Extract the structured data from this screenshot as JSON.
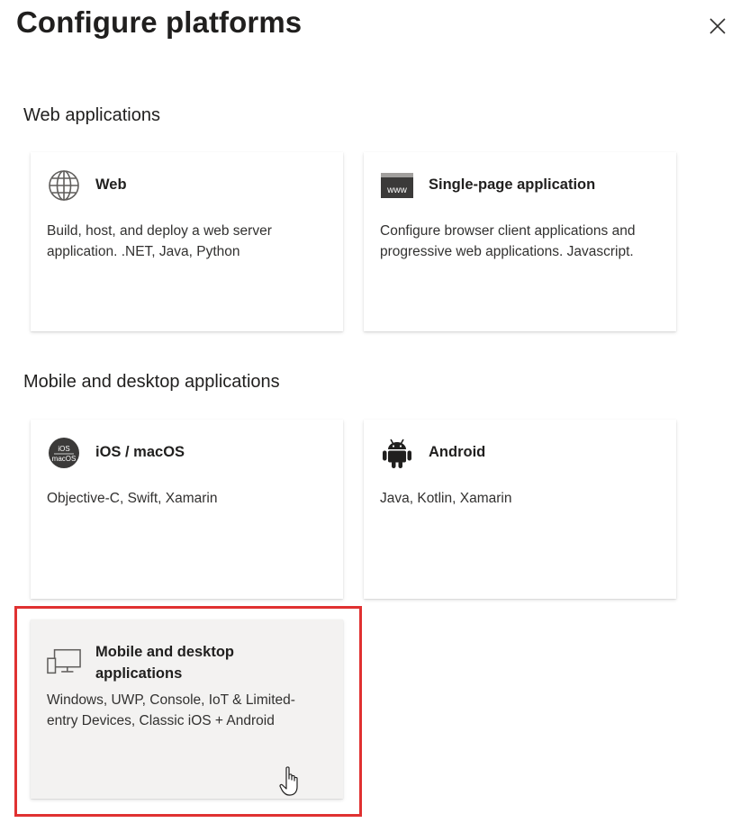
{
  "panel": {
    "title": "Configure platforms",
    "close_label": "×"
  },
  "sections": [
    {
      "heading": "Web applications",
      "cards": [
        {
          "icon": "globe-icon",
          "title": "Web",
          "description": "Build, host, and deploy a web server application. .NET, Java, Python"
        },
        {
          "icon": "browser-window-icon",
          "icon_text": "www",
          "title": "Single-page application",
          "description": "Configure browser client applications and progressive web applications. Javascript."
        }
      ]
    },
    {
      "heading": "Mobile and desktop applications",
      "cards": [
        {
          "icon": "ios-macos-badge-icon",
          "icon_text_top": "iOS",
          "icon_text_bottom": "macOS",
          "title": "iOS / macOS",
          "description": "Objective-C, Swift, Xamarin"
        },
        {
          "icon": "android-robot-icon",
          "title": "Android",
          "description": "Java, Kotlin, Xamarin"
        },
        {
          "icon": "desktop-monitor-icon",
          "title": "Mobile and desktop\napplications",
          "description": "Windows, UWP, Console, IoT & Limited-entry Devices, Classic iOS + Android",
          "state": "hovered"
        }
      ]
    }
  ],
  "colors": {
    "highlight": "#e03131",
    "card_hover_bg": "#f3f2f1",
    "text": "#201f1e"
  }
}
